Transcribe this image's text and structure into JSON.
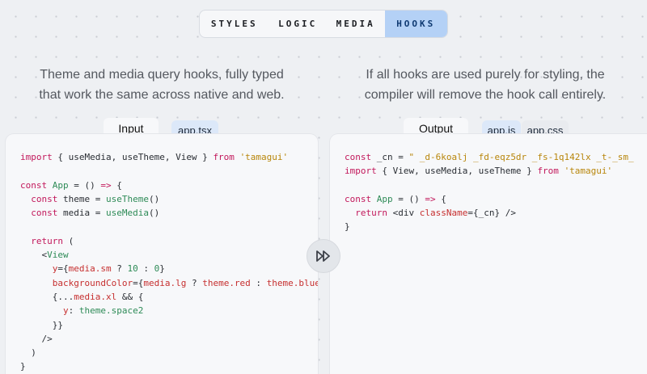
{
  "tabs": [
    {
      "label": "STYLES",
      "active": false
    },
    {
      "label": "LOGIC",
      "active": false
    },
    {
      "label": "MEDIA",
      "active": false
    },
    {
      "label": "HOOKS",
      "active": true
    }
  ],
  "left": {
    "description": [
      "Theme and media query hooks, fully typed",
      "that work the same across native and web."
    ],
    "tab_label": "Input",
    "file_tab": "app.tsx"
  },
  "right": {
    "description": [
      "If all hooks are used purely for styling, the",
      "compiler will remove the hook call entirely."
    ],
    "tab_label": "Output",
    "file_tabs": [
      "app.js",
      "app.css"
    ]
  },
  "colors": {
    "accent": "#b4d1f6",
    "keyword": "#c2185b",
    "function": "#2e8b57",
    "string": "#b8860b",
    "attr": "#c62f2f"
  },
  "icons": {
    "middle_button": "fast-forward-icon"
  }
}
